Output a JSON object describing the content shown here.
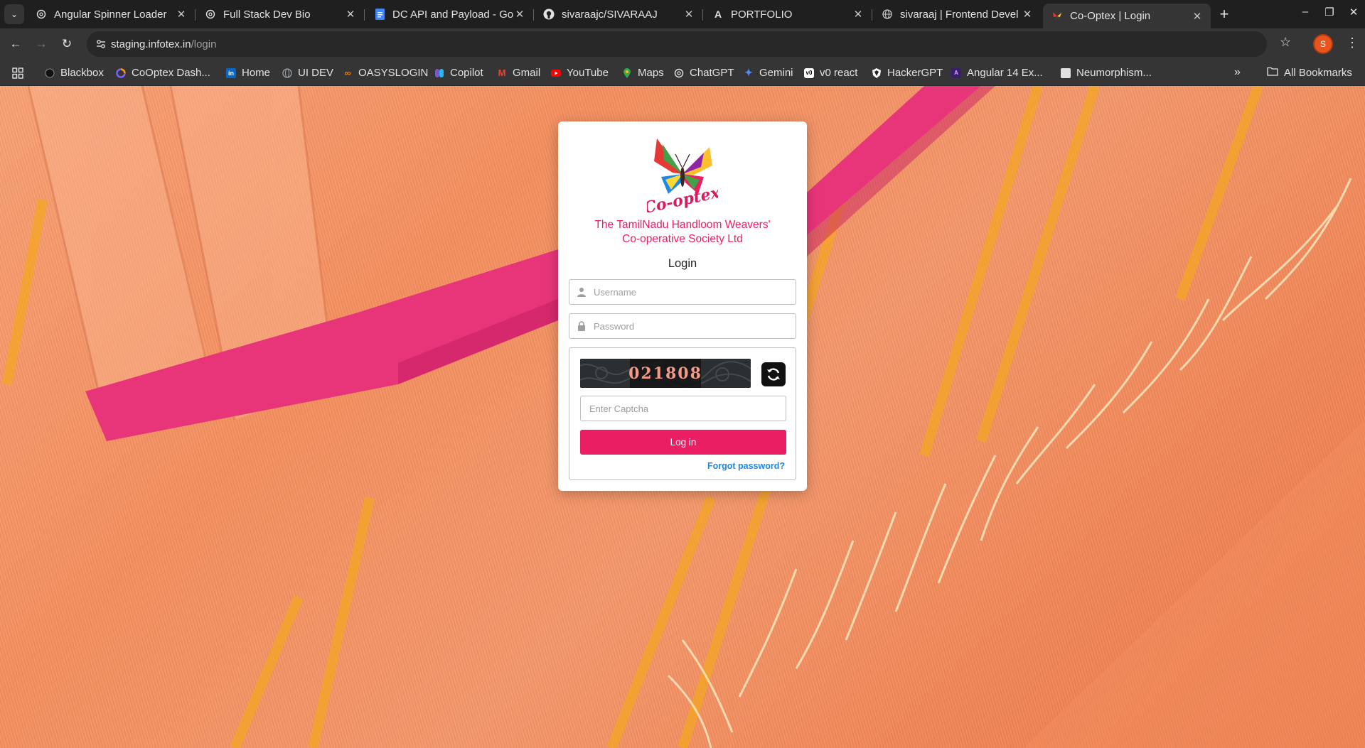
{
  "browser": {
    "tabs": [
      {
        "title": "Angular Spinner Loader",
        "icon": "chatgpt-icon",
        "active": false
      },
      {
        "title": "Full Stack Dev Bio",
        "icon": "chatgpt-icon",
        "active": false
      },
      {
        "title": "DC API and Payload - Goo",
        "icon": "google-docs-icon",
        "active": false
      },
      {
        "title": "sivaraajc/SIVARAAJ",
        "icon": "github-icon",
        "active": false
      },
      {
        "title": "PORTFOLIO",
        "icon": "portfolio-icon",
        "active": false
      },
      {
        "title": "sivaraaj | Frontend Devel",
        "icon": "globe-icon",
        "active": false
      },
      {
        "title": "Co-Optex | Login",
        "icon": "butterfly-icon",
        "active": true
      }
    ],
    "new_tab_label": "+",
    "address": {
      "host": "staging.infotex.in",
      "path": "/login"
    },
    "profile_initial": "S",
    "bookmarks": [
      {
        "label": "Blackbox",
        "icon": "blackbox-icon",
        "color": "#111111"
      },
      {
        "label": "CoOptex Dash...",
        "icon": "cooptex-icon",
        "color": "#7b61ff"
      },
      {
        "label": "Home",
        "icon": "linkedin-icon",
        "color": "#0a66c2"
      },
      {
        "label": "UI DEV",
        "icon": "globe-icon",
        "color": "#9aa0a6"
      },
      {
        "label": "OASYSLOGIN",
        "icon": "oasys-icon",
        "color": "#f57c00"
      },
      {
        "label": "Copilot",
        "icon": "copilot-icon",
        "color": "#7e57c2"
      },
      {
        "label": "Gmail",
        "icon": "gmail-icon",
        "color": "#ea4335"
      },
      {
        "label": "YouTube",
        "icon": "youtube-icon",
        "color": "#ff0000"
      },
      {
        "label": "Maps",
        "icon": "maps-icon",
        "color": "#34a853"
      },
      {
        "label": "ChatGPT",
        "icon": "chatgpt-icon",
        "color": "#e3e3e3"
      },
      {
        "label": "Gemini",
        "icon": "gemini-icon",
        "color": "#4f8cff"
      },
      {
        "label": "v0 react",
        "icon": "v0-icon",
        "color": "#ffffff"
      },
      {
        "label": "HackerGPT",
        "icon": "hackergpt-icon",
        "color": "#ffffff"
      },
      {
        "label": "Angular 14 Ex...",
        "icon": "angular-icon",
        "color": "#8e24aa"
      },
      {
        "label": "Neumorphism...",
        "icon": "page-icon",
        "color": "#e0e0e0"
      }
    ],
    "all_bookmarks_label": "All Bookmarks"
  },
  "login": {
    "logo_text": "Co-optex",
    "org_line1": "The TamilNadu Handloom Weavers'",
    "org_line2": "Co-operative Society Ltd",
    "title": "Login",
    "username_placeholder": "Username",
    "password_placeholder": "Password",
    "captcha_code": "021808",
    "captcha_placeholder": "Enter Captcha",
    "login_button": "Log in",
    "forgot_link": "Forgot password?"
  },
  "colors": {
    "brand_pink": "#e91e63",
    "link_blue": "#1e88e5"
  }
}
